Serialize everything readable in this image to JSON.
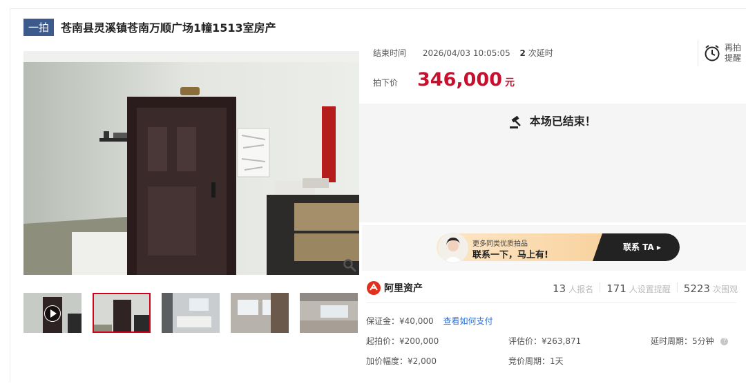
{
  "title": {
    "badge": "一拍",
    "text": "苍南县灵溪镇苍南万顺广场1幢1513室房产"
  },
  "auction": {
    "end_time_label": "结束时间",
    "end_time": "2026/04/03 10:05:05",
    "delay_count": "2",
    "delay_suffix": "次延时",
    "remind_line1": "再拍",
    "remind_line2": "提醒",
    "final_price_label": "拍下价",
    "final_price": "346,000",
    "price_unit": "元",
    "ended_text": "本场已结束！"
  },
  "promo": {
    "sub_text": "更多同类优质拍品",
    "main_text": "联系一下，马上有!",
    "cta": "联系 TA"
  },
  "brand": {
    "name": "阿里资产"
  },
  "stats": [
    {
      "num": "13",
      "label": "人报名"
    },
    {
      "num": "171",
      "label": "人设置提醒"
    },
    {
      "num": "5223",
      "label": "次围观"
    }
  ],
  "details": {
    "deposit": "保证金：¥40,000",
    "how_to_pay": "查看如何支付",
    "start_price": "起拍价：¥200,000",
    "evaluation": "评估价：¥263,871",
    "delay_period": "延时周期：5分钟",
    "increment": "加价幅度：¥2,000",
    "bid_period": "竞价周期：1天"
  },
  "colors": {
    "price": "#c8102e",
    "badge": "#3d5a8c",
    "link": "#2b6fd6"
  }
}
